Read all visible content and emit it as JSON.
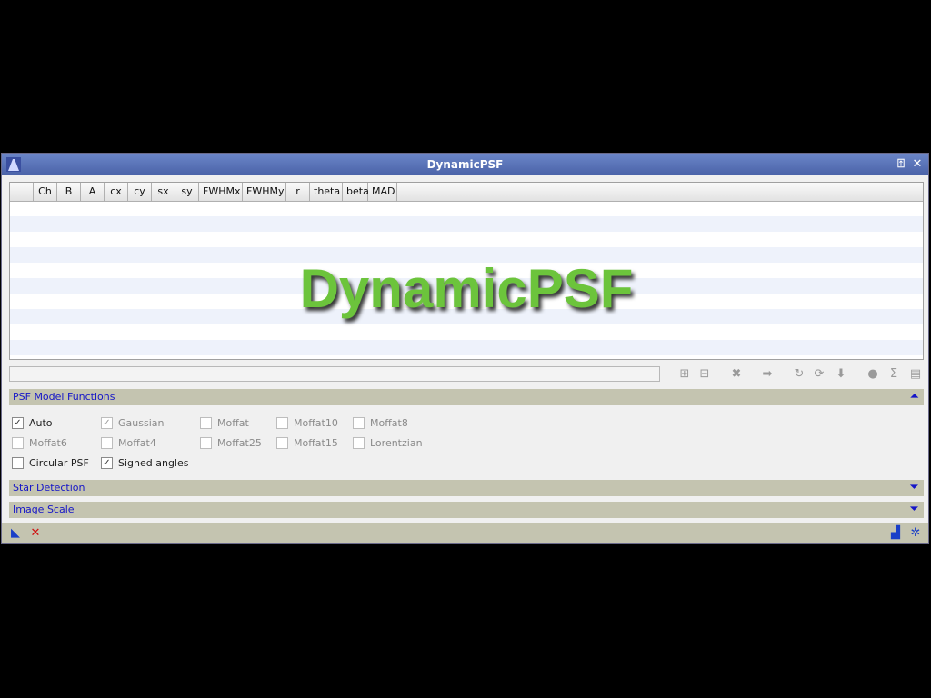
{
  "window": {
    "title": "DynamicPSF"
  },
  "table": {
    "columns": [
      "",
      "Ch",
      "B",
      "A",
      "cx",
      "cy",
      "sx",
      "sy",
      "FWHMx",
      "FWHMy",
      "r",
      "theta",
      "beta",
      "MAD"
    ],
    "watermark": "DynamicPSF"
  },
  "status": {
    "info": ""
  },
  "sections": {
    "psf_model": {
      "label": "PSF Model Functions"
    },
    "star_detection": {
      "label": "Star Detection"
    },
    "image_scale": {
      "label": "Image Scale"
    }
  },
  "psf_options": {
    "auto": {
      "label": "Auto",
      "checked": true
    },
    "gaussian": {
      "label": "Gaussian",
      "checked": true
    },
    "moffat": {
      "label": "Moffat",
      "checked": false
    },
    "moffat10": {
      "label": "Moffat10",
      "checked": false
    },
    "moffat8": {
      "label": "Moffat8",
      "checked": false
    },
    "moffat6": {
      "label": "Moffat6",
      "checked": false
    },
    "moffat4": {
      "label": "Moffat4",
      "checked": false
    },
    "moffat25": {
      "label": "Moffat25",
      "checked": false
    },
    "moffat15": {
      "label": "Moffat15",
      "checked": false
    },
    "lorentzian": {
      "label": "Lorentzian",
      "checked": false
    },
    "circular": {
      "label": "Circular PSF",
      "checked": false
    },
    "signed_angles": {
      "label": "Signed angles",
      "checked": true
    }
  },
  "colors": {
    "accent": "#1515c8",
    "watermark": "#6cc43c",
    "titlebar": "#5a72b8"
  }
}
